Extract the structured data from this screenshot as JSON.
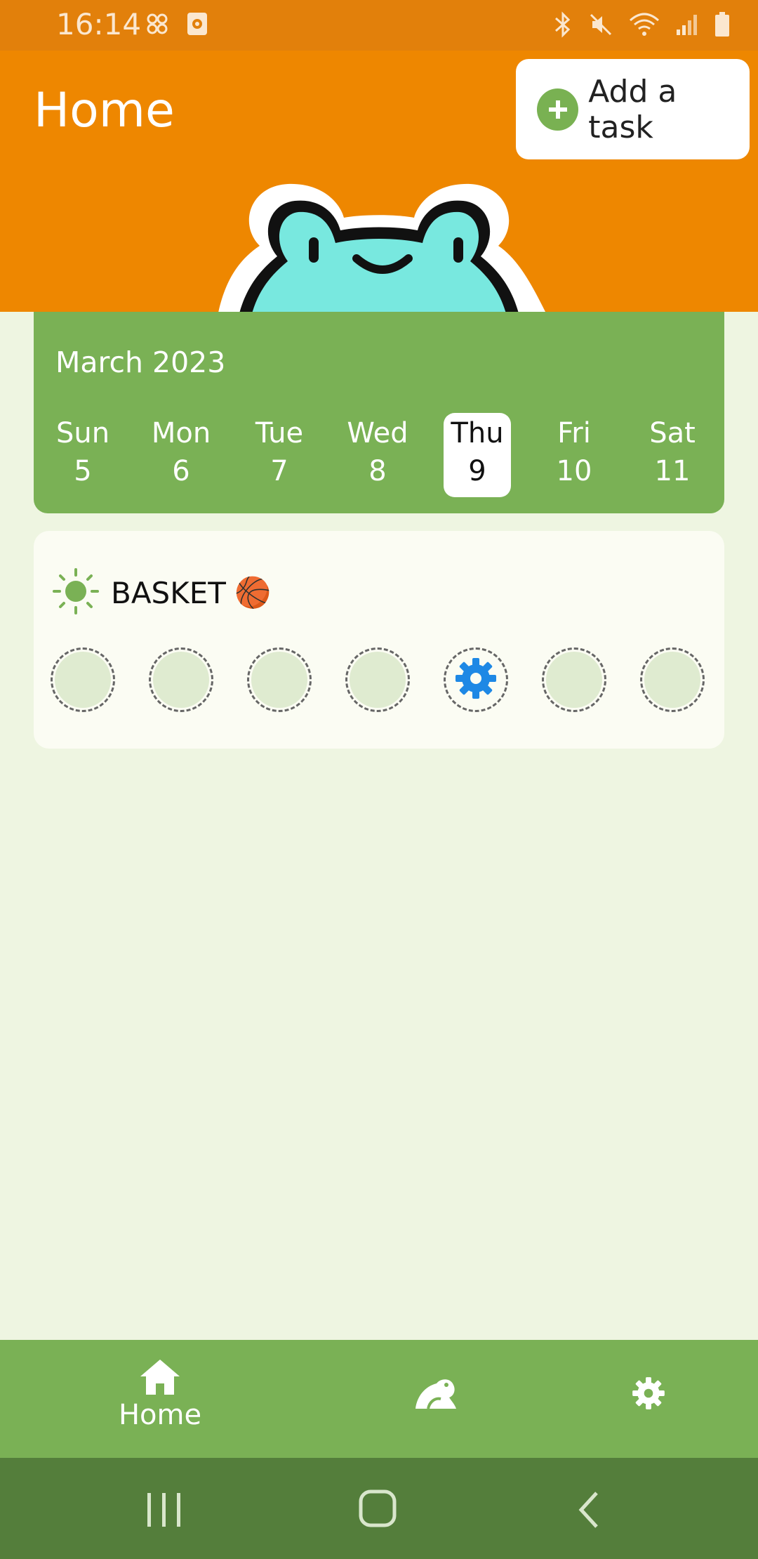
{
  "status_bar": {
    "time": "16:14"
  },
  "app_bar": {
    "title": "Home",
    "add_task_label": "Add a task"
  },
  "calendar": {
    "month": "March 2023",
    "days": [
      {
        "name": "Sun",
        "num": "5"
      },
      {
        "name": "Mon",
        "num": "6"
      },
      {
        "name": "Tue",
        "num": "7"
      },
      {
        "name": "Wed",
        "num": "8"
      },
      {
        "name": "Thu",
        "num": "9",
        "selected": true
      },
      {
        "name": "Fri",
        "num": "10"
      },
      {
        "name": "Sat",
        "num": "11"
      }
    ]
  },
  "task": {
    "icon": "sun-icon",
    "title": "BASKET",
    "emoji": "🏀",
    "days_status": [
      "empty",
      "empty",
      "empty",
      "empty",
      "settings",
      "empty",
      "empty"
    ]
  },
  "bottom_nav": {
    "home_label": "Home",
    "frog_icon": "frog-icon",
    "settings_icon": "gear-icon"
  },
  "colors": {
    "status_bar": "#e2800b",
    "app_bar": "#ee8700",
    "accent_green": "#7ab155",
    "background": "#eef5e1",
    "system_nav": "#547e3b",
    "gear_blue": "#1e88e5",
    "frog_teal": "#78e8df"
  }
}
